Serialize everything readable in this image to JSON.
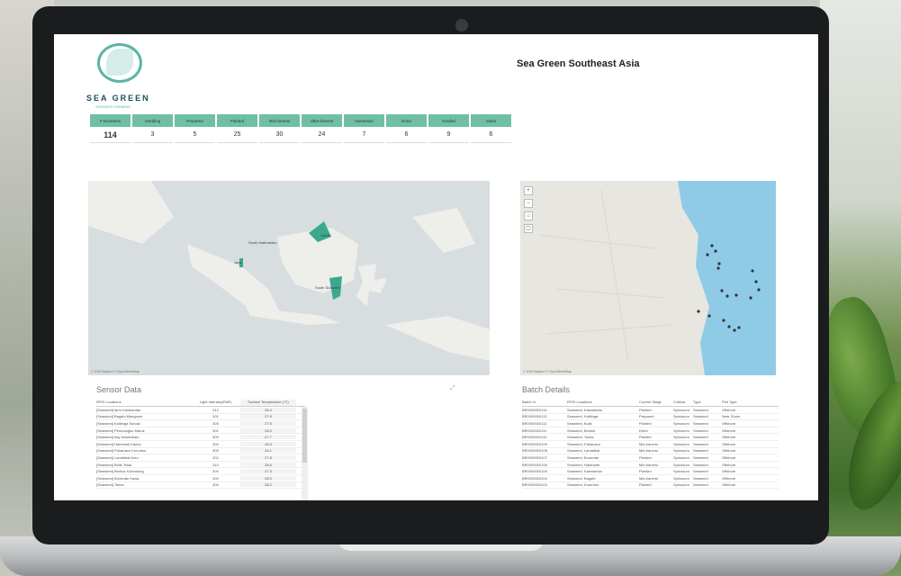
{
  "app": {
    "title": "Sea Green Southeast Asia",
    "logo_text": "SEA GREEN",
    "logo_sub": "SEAWEED FARMING"
  },
  "kpi": {
    "headers": [
      "# Nurseries",
      "Seedling",
      "Prepared",
      "Planted",
      "Mid-harvest",
      "Ultra-harvest",
      "Harvested",
      "Dried",
      "Graded",
      "Sales"
    ],
    "values": [
      "114",
      "3",
      "5",
      "25",
      "30",
      "24",
      "7",
      "6",
      "9",
      "6"
    ]
  },
  "map_main": {
    "labels": [
      "Sabah",
      "South Kalimantan",
      "South Sulawesi",
      "Java"
    ],
    "attribution": "© 2023 Mapbox  © OpenStreetMap"
  },
  "map_detail": {
    "attribution": "© 2023 Mapbox  © OpenStreetMap",
    "controls": [
      "+",
      "−",
      "⌂",
      "▢"
    ]
  },
  "sensor": {
    "title": "Sensor Data",
    "expand_icon": "⤢",
    "columns": [
      "RFID Locations",
      "Light Intensity(PAR)",
      "Surface Temperature (°C)"
    ],
    "rows": [
      [
        "[Seaweed] farm Kalimantan",
        "312",
        "28.4"
      ],
      [
        "[Seaweed] Bagahi Mangrove",
        "301",
        "27.9"
      ],
      [
        "[Seaweed] Kalitinga Sunuki",
        "305",
        "27.5"
      ],
      [
        "[Seaweed] Pemuangku Maruk",
        "301",
        "28.0"
      ],
      [
        "[Seaweed] bay Kawanbatu",
        "300",
        "27.7"
      ],
      [
        "[Seaweed] Hambanti Kanbu",
        "300",
        "28.3"
      ],
      [
        "[Seaweed] Pahanaco Kuruntun",
        "305",
        "28.1"
      ],
      [
        "[Seaweed] Lamatibal Anru",
        "302",
        "27.8"
      ],
      [
        "[Seaweed] Bulik Teluk",
        "310",
        "28.6"
      ],
      [
        "[Seaweed] Bentuk Kolondong",
        "300",
        "27.3"
      ],
      [
        "[Seaweed] Bonerate Kawa",
        "300",
        "28.0"
      ],
      [
        "[Seaweed] Tomia",
        "300",
        "28.2"
      ]
    ]
  },
  "batch": {
    "title": "Batch Details",
    "columns": [
      "Batch Id",
      "RFID Locations",
      "Current Stage",
      "Cultivar",
      "Type",
      "Plot Type"
    ],
    "rows": [
      [
        "BR0000000114",
        "Seaweed, Kawanbatu",
        "Planted",
        "Spinosum",
        "Seaweed",
        "Offshore"
      ],
      [
        "BR0000000113",
        "Seaweed, Kalitinga",
        "Prepared",
        "Spinosum",
        "Seaweed",
        "Near Shore"
      ],
      [
        "BR0000000112",
        "Seaweed, Bulik",
        "Planted",
        "Spinosum",
        "Seaweed",
        "Offshore"
      ],
      [
        "BR0000000111",
        "Seaweed, Bentuk",
        "Dried",
        "Spinosum",
        "Seaweed",
        "Offshore"
      ],
      [
        "BR0000000110",
        "Seaweed, Tomia",
        "Planted",
        "Spinosum",
        "Seaweed",
        "Offshore"
      ],
      [
        "BR0000000109",
        "Seaweed, Pahanaco",
        "Mid-harvest",
        "Spinosum",
        "Seaweed",
        "Offshore"
      ],
      [
        "BR0000000108",
        "Seaweed, Lamatibal",
        "Mid-harvest",
        "Spinosum",
        "Seaweed",
        "Offshore"
      ],
      [
        "BR0000000107",
        "Seaweed, Bonerate",
        "Planted",
        "Spinosum",
        "Seaweed",
        "Offshore"
      ],
      [
        "BR0000000106",
        "Seaweed, Hambanti",
        "Mid-harvest",
        "Spinosum",
        "Seaweed",
        "Offshore"
      ],
      [
        "BR0000000105",
        "Seaweed, Kalimantan",
        "Planted",
        "Spinosum",
        "Seaweed",
        "Offshore"
      ],
      [
        "BR0000000104",
        "Seaweed, Bagahi",
        "Mid-harvest",
        "Spinosum",
        "Seaweed",
        "Offshore"
      ],
      [
        "BR0000000103",
        "Seaweed, Kuruntun",
        "Planted",
        "Spinosum",
        "Seaweed",
        "Offshore"
      ]
    ]
  },
  "colors": {
    "accent": "#6fbfa4",
    "map_marker": "#3aa88f",
    "sea": "#8fcbe6",
    "bezel": "#1b1c1e"
  }
}
